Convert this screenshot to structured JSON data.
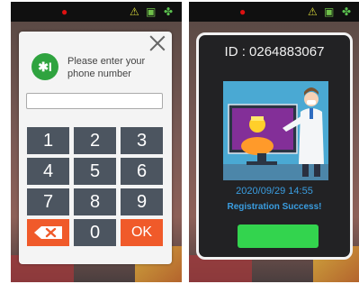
{
  "left_screen": {
    "dialog": {
      "prompt": "Please enter your phone number",
      "input_value": "",
      "keys": [
        "1",
        "2",
        "3",
        "4",
        "5",
        "6",
        "7",
        "8",
        "9",
        "",
        "0",
        "OK"
      ]
    }
  },
  "right_screen": {
    "card": {
      "id_text": "ID : 0264883067",
      "datetime": "2020/09/29 14:55",
      "status": "Registration Success!"
    }
  },
  "colors": {
    "accent_green": "#33d44e",
    "accent_orange": "#f05a2a",
    "accent_blue": "#3a9de0",
    "key_gray": "#4c5560"
  }
}
